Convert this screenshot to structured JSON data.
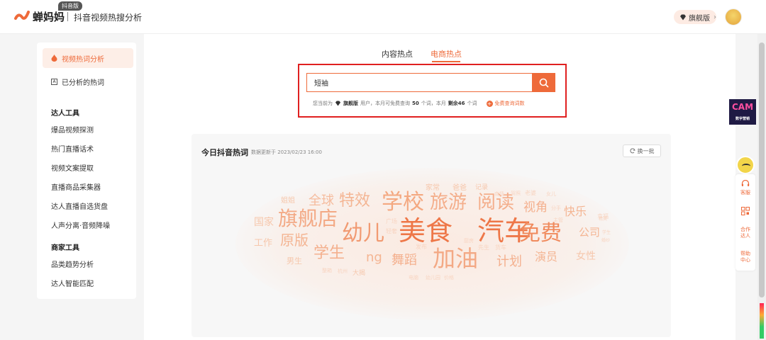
{
  "header": {
    "brand": "蝉妈妈",
    "brand_tag": "抖音版",
    "app_title": "抖音视频热搜分析",
    "vip_label": "旗舰版",
    "vip_arrow": "›"
  },
  "sidebar": {
    "active_item": "视频热词分析",
    "item_analyzed": "已分析的热词",
    "group_creator": "达人工具",
    "creator_items": [
      "爆品视频探测",
      "热门直播话术",
      "视频文案提取",
      "直播商品采集器",
      "达人直播自选货盘",
      "人声分离·音频降噪"
    ],
    "group_merchant": "商家工具",
    "merchant_items": [
      "品类趋势分析",
      "达人智能匹配"
    ]
  },
  "tabs": [
    "内容热点",
    "电商热点"
  ],
  "active_tab_index": 1,
  "search": {
    "value": "短袖",
    "quota_prefix": "您当前为",
    "plan": "旗舰版",
    "quota_mid": "用户，本月可免费查询",
    "quota_total": "50",
    "quota_unit1": "个词，本月",
    "quota_remaining_label": "剩余46",
    "quota_unit2": "个词",
    "free_link": "免费查询词数"
  },
  "card": {
    "title": "今日抖音热词",
    "update_time": "数据更新于 2023/02/23 16:00",
    "refresh_label": "换一批"
  },
  "word_cloud": [
    {
      "t": "美食",
      "c": "#ee7748"
    },
    {
      "t": "汽车",
      "c": "#ee7748"
    },
    {
      "t": "幼儿",
      "c": "#f19a72"
    },
    {
      "t": "免费",
      "c": "#f08a5d"
    },
    {
      "t": "加油",
      "c": "#f3a985"
    },
    {
      "t": "旗舰店",
      "c": "#f3a985"
    },
    {
      "t": "学校",
      "c": "#f4a880"
    },
    {
      "t": "旅游",
      "c": "#f4ae8b"
    },
    {
      "t": "阅读",
      "c": "#f4ae8b"
    },
    {
      "t": "特效",
      "c": "#f4b593"
    },
    {
      "t": "全球",
      "c": "#f5bc9e"
    },
    {
      "t": "学生",
      "c": "#f4b08e"
    },
    {
      "t": "原版",
      "c": "#f4b593"
    },
    {
      "t": "舞蹈",
      "c": "#f4b08e"
    },
    {
      "t": "ng",
      "c": "#f4b593"
    },
    {
      "t": "计划",
      "c": "#f4b08e"
    },
    {
      "t": "演员",
      "c": "#f4b593"
    },
    {
      "t": "视角",
      "c": "#f4b08e"
    },
    {
      "t": "快乐",
      "c": "#f4b593"
    },
    {
      "t": "公司",
      "c": "#f4b593"
    },
    {
      "t": "女性",
      "c": "#f6c7ac"
    },
    {
      "t": "国家",
      "c": "#f6c7ac"
    },
    {
      "t": "工作",
      "c": "#f6c7ac"
    },
    {
      "t": "姐姐",
      "c": "#f6c7ac"
    },
    {
      "t": "男生",
      "c": "#f6c7ac"
    },
    {
      "t": "家常",
      "c": "#f6c7ac"
    },
    {
      "t": "爸爸",
      "c": "#f6c7ac"
    },
    {
      "t": "记录",
      "c": "#f6c7ac"
    },
    {
      "t": "大揭",
      "c": "#f6c7ac"
    },
    {
      "t": "发布",
      "c": "#f8d5c2"
    },
    {
      "t": "先生",
      "c": "#f8d5c2"
    },
    {
      "t": "货车",
      "c": "#f8d5c2"
    },
    {
      "t": "老婆",
      "c": "#f8d5c2"
    },
    {
      "t": "女儿",
      "c": "#f8d5c2"
    },
    {
      "t": "幸福",
      "c": "#f8d5c2"
    },
    {
      "t": "商场",
      "c": "#f8d5c2"
    },
    {
      "t": "驾照",
      "c": "#f8d5c2"
    },
    {
      "t": "整箱",
      "c": "#f8d5c2"
    },
    {
      "t": "杭州",
      "c": "#f8d5c2"
    },
    {
      "t": "广场",
      "c": "#f8d5c2"
    },
    {
      "t": "轻奢",
      "c": "#f8d5c2"
    },
    {
      "t": "电脑",
      "c": "#f8d5c2"
    },
    {
      "t": "幼儿园",
      "c": "#f8d5c2"
    },
    {
      "t": "价格",
      "c": "#f8d5c2"
    },
    {
      "t": "分手",
      "c": "#f8d5c2"
    },
    {
      "t": "主管",
      "c": "#f8d5c2"
    },
    {
      "t": "厨房",
      "c": "#f8d5c2"
    },
    {
      "t": "学生",
      "c": "#f8d5c2"
    },
    {
      "t": "婚纱",
      "c": "#f8d5c2"
    },
    {
      "t": "精英",
      "c": "#f8d5c2"
    }
  ],
  "float_bar": {
    "promo": "CAM",
    "promo_sub": "数字营销",
    "items": [
      "客服",
      "合作\n达人",
      "帮助\n中心"
    ]
  },
  "colors": {
    "accent": "#ee6a3a",
    "highlight_box": "#e02020"
  }
}
